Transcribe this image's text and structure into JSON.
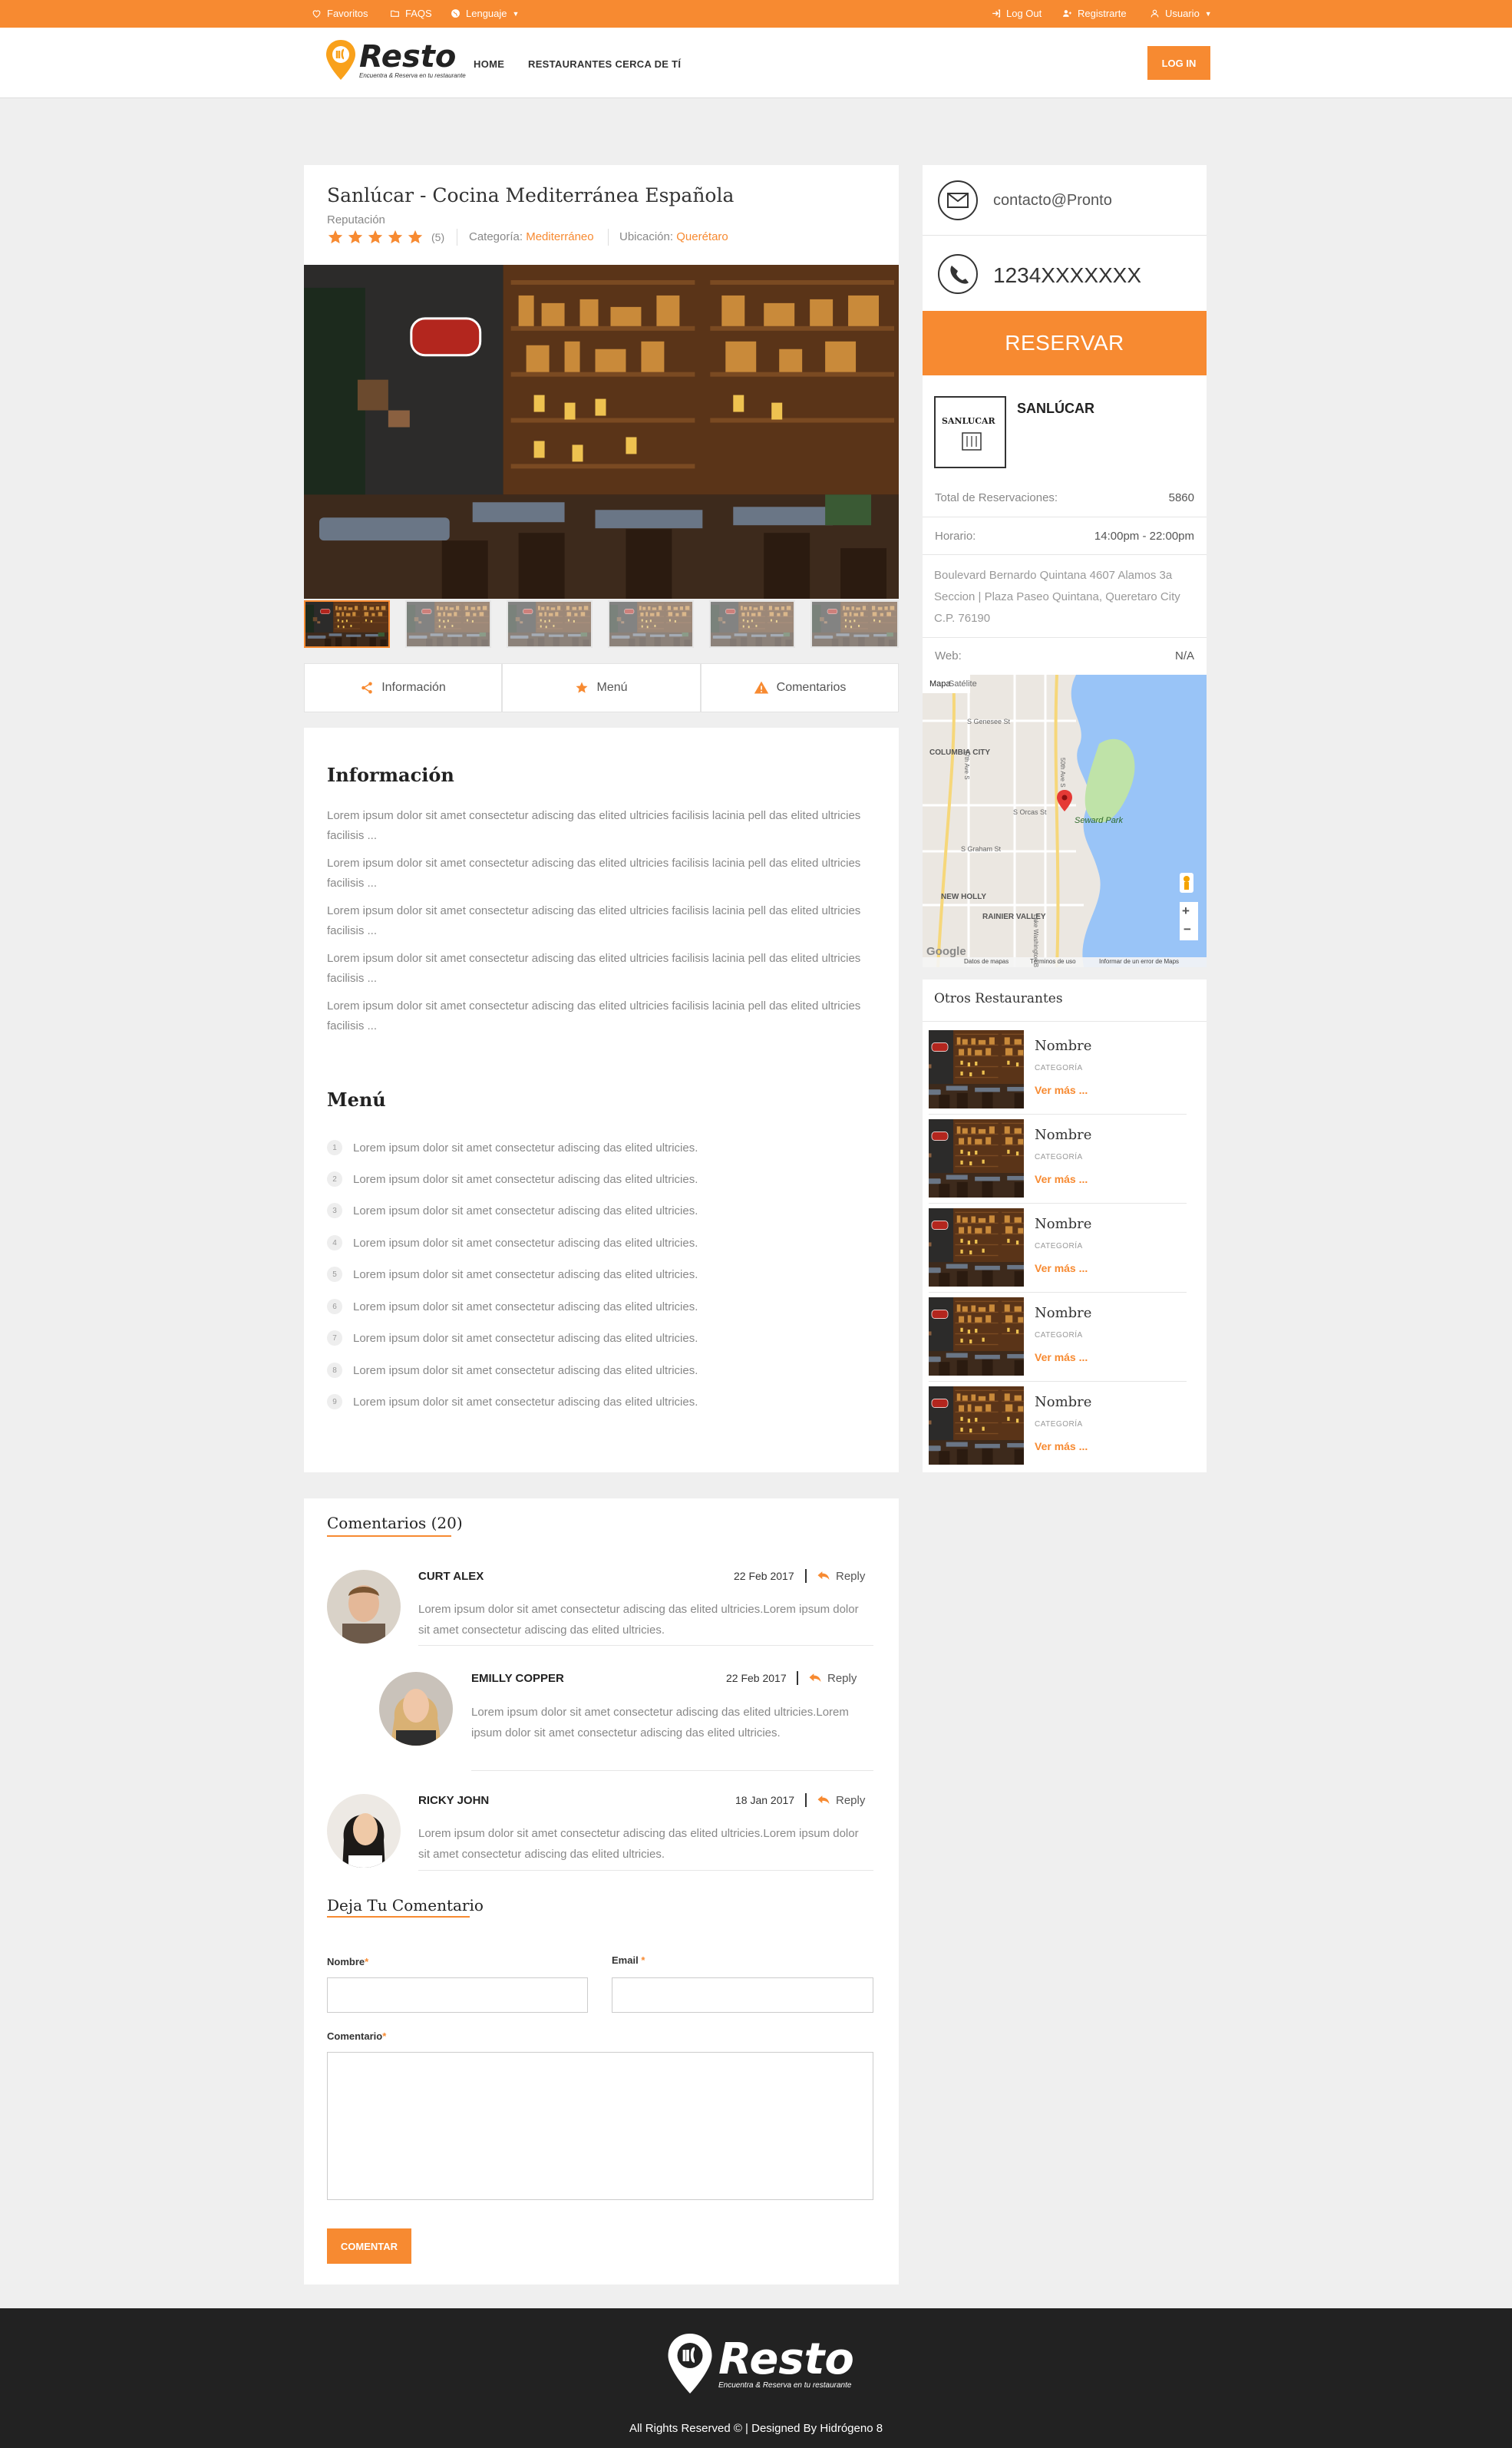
{
  "topbar": {
    "favoritos": "Favoritos",
    "faqs": "FAQS",
    "lenguaje": "Lenguaje",
    "logout": "Log Out",
    "registrarte": "Registrarte",
    "usuario": "Usuario"
  },
  "brand": {
    "name": "Resto",
    "tagline": "Encuentra & Reserva en tu restaurante",
    "accent": "#f78a31"
  },
  "nav": {
    "home": "HOME",
    "nearby": "RESTAURANTES CERCA DE TÍ",
    "login": "LOG IN"
  },
  "restaurant": {
    "title": "Sanlúcar - Cocina Mediterránea Española",
    "reputation_label": "Reputación",
    "rating": 5,
    "rating_text": "(5)",
    "category_label": "Categoría:",
    "category": "Mediterráneo",
    "location_label": "Ubicación:",
    "location": "Querétaro"
  },
  "tabs": [
    "Información",
    "Menú",
    "Comentarios"
  ],
  "info": {
    "heading": "Información",
    "paragraphs": [
      "Lorem ipsum dolor sit amet consectetur adiscing das elited ultricies facilisis lacinia pell das elited ultricies facilisis ...",
      "Lorem ipsum dolor sit amet consectetur adiscing das elited ultricies facilisis lacinia pell das elited ultricies facilisis ...",
      "Lorem ipsum dolor sit amet consectetur adiscing das elited ultricies facilisis lacinia pell das elited ultricies facilisis ...",
      "Lorem ipsum dolor sit amet consectetur adiscing das elited ultricies facilisis lacinia pell das elited ultricies facilisis ...",
      "Lorem ipsum dolor sit amet consectetur adiscing das elited ultricies facilisis lacinia pell das elited ultricies facilisis ..."
    ]
  },
  "menu": {
    "heading": "Menú",
    "items": [
      {
        "num": "1",
        "text": "Lorem ipsum dolor sit amet consectetur adiscing das elited ultricies."
      },
      {
        "num": "2",
        "text": "Lorem ipsum dolor sit amet consectetur adiscing das elited ultricies."
      },
      {
        "num": "3",
        "text": "Lorem ipsum dolor sit amet consectetur adiscing das elited ultricies."
      },
      {
        "num": "4",
        "text": "Lorem ipsum dolor sit amet consectetur adiscing das elited ultricies."
      },
      {
        "num": "5",
        "text": "Lorem ipsum dolor sit amet consectetur adiscing das elited ultricies."
      },
      {
        "num": "6",
        "text": "Lorem ipsum dolor sit amet consectetur adiscing das elited ultricies."
      },
      {
        "num": "7",
        "text": "Lorem ipsum dolor sit amet consectetur adiscing das elited ultricies."
      },
      {
        "num": "8",
        "text": "Lorem ipsum dolor sit amet consectetur adiscing das elited ultricies."
      },
      {
        "num": "9",
        "text": "Lorem ipsum dolor sit amet consectetur adiscing das elited ultricies."
      }
    ]
  },
  "comments": {
    "heading": "Comentarios (20)",
    "reply_label": "Reply",
    "items": [
      {
        "name": "CURT ALEX",
        "date": "22 Feb 2017",
        "text": "Lorem ipsum dolor sit amet consectetur adiscing das elited ultricies.Lorem ipsum dolor sit amet consectetur adiscing das elited ultricies."
      },
      {
        "name": "EMILLY COPPER",
        "date": "22 Feb 2017",
        "text": "Lorem ipsum dolor sit amet consectetur adiscing das elited ultricies.Lorem ipsum dolor sit amet consectetur adiscing das elited ultricies."
      },
      {
        "name": "RICKY JOHN",
        "date": "18 Jan 2017",
        "text": "Lorem ipsum dolor sit amet consectetur adiscing das elited ultricies.Lorem ipsum dolor sit amet consectetur adiscing das elited ultricies."
      }
    ]
  },
  "form": {
    "heading": "Deja Tu Comentario",
    "nombre_label": "Nombre",
    "email_label": "Email",
    "comentario_label": "Comentario",
    "required_mark": "*",
    "submit": "COMENTAR"
  },
  "sidebar": {
    "email": "contacto@Pronto",
    "phone": "1234XXXXXXX",
    "reserve": "RESERVAR",
    "name": "SANLÚCAR",
    "logo_text": "SANLUCAR",
    "total_label": "Total de Reservaciones:",
    "total_value": "5860",
    "hours_label": "Horario:",
    "hours_value": "14:00pm - 22:00pm",
    "address": "Boulevard Bernardo Quintana 4607 Alamos 3a Seccion | Plaza Paseo Quintana, Queretaro City C.P. 76190",
    "web_label": "Web:",
    "web_value": "N/A"
  },
  "map": {
    "tab_map": "Mapa",
    "tab_sat": "Satélite",
    "labels": [
      "S Genesee St",
      "COLUMBIA CITY",
      "S Orcas St",
      "Seward Park",
      "S Graham St",
      "NEW HOLLY",
      "RAINIER VALLEY",
      "47th Ave S",
      "50th Ave S",
      "Lake Washington Blvd S"
    ],
    "zoom_in": "+",
    "zoom_out": "−",
    "footer": [
      "Datos de mapas",
      "Términos de uso",
      "Informar de un error de Maps"
    ],
    "google": "Google",
    "water": "#99c4f7",
    "park": "#bfe3a8"
  },
  "others": {
    "heading": "Otros Restaurantes",
    "items": [
      {
        "name": "Nombre",
        "category": "CATEGORÍA",
        "more": "Ver más ..."
      },
      {
        "name": "Nombre",
        "category": "CATEGORÍA",
        "more": "Ver más ..."
      },
      {
        "name": "Nombre",
        "category": "CATEGORÍA",
        "more": "Ver más ..."
      },
      {
        "name": "Nombre",
        "category": "CATEGORÍA",
        "more": "Ver más ..."
      },
      {
        "name": "Nombre",
        "category": "CATEGORÍA",
        "more": "Ver más ..."
      }
    ]
  },
  "footer": {
    "copyright": "All Rights Reserved © | Designed By Hidrógeno 8"
  }
}
